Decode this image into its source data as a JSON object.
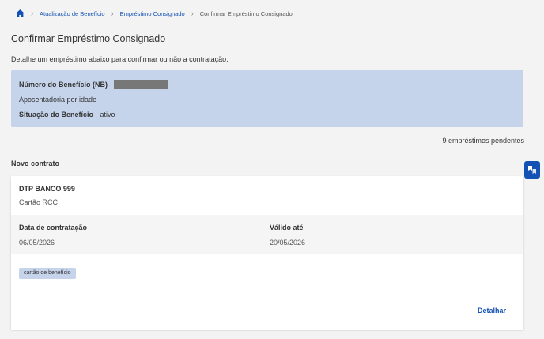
{
  "breadcrumb": {
    "items": [
      "Atualização de Benefício",
      "Empréstimo Consignado"
    ],
    "current": "Confirmar Empréstimo Consignado"
  },
  "page": {
    "title": "Confirmar Empréstimo Consignado",
    "subtitle": "Detalhe um empréstimo abaixo para confirmar ou não a contratação."
  },
  "benefit": {
    "nb_label": "Número do Benefício (NB)",
    "type": "Aposentadoria por idade",
    "status_label": "Situação do Benefício",
    "status_value": "ativo"
  },
  "pending_text": "9 empréstimos pendentes",
  "section_title": "Novo contrato",
  "contract": {
    "bank": "DTP BANCO 999",
    "product": "Cartão RCC",
    "contract_date_label": "Data de contratação",
    "contract_date": "06/05/2026",
    "valid_until_label": "Válido até",
    "valid_until": "20/05/2026",
    "tag": "cartão de benefício",
    "detail_link": "Detalhar"
  },
  "icons": [
    "home-icon",
    "chevron-right-icon",
    "accessibility-icon"
  ],
  "colors": {
    "primary": "#1351b4",
    "highlight_bg": "#c5d4eb",
    "page_bg": "#f3f3f3"
  }
}
